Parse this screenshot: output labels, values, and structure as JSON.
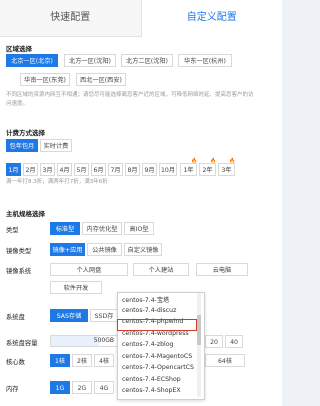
{
  "tabs": [
    {
      "label": "快速配置"
    },
    {
      "label": "自定义配置"
    }
  ],
  "region": {
    "title": "区域选择",
    "options": [
      "北京一区(北京)",
      "北方一区(沈阳)",
      "北方二区(沈阳)",
      "华东一区(杭州)",
      "华南一区(东莞)",
      "西北一区(西安)"
    ],
    "note_line1": "不同区域的资源内网互不相通；请您尽可能选择离您客户近的区域，可降低网络时延、提高您客户的访",
    "note_line2": "问速度。"
  },
  "billing": {
    "title": "计费方式选择",
    "options": [
      "包年包月",
      "实时计费"
    ],
    "months": [
      "1月",
      "2月",
      "3月",
      "4月",
      "5月",
      "6月",
      "7月",
      "8月",
      "9月",
      "10月",
      "1年",
      "2年",
      "3年"
    ],
    "note": "满一年打8.3折，满两年打7折，满3年6折"
  },
  "host": {
    "title": "主机规格选择",
    "type_label": "类型",
    "type_options": [
      "标准型",
      "内存优化型",
      "高IO型"
    ],
    "image_type_label": "镜像类型",
    "image_type_options": [
      "镜像+应用",
      "公共镜像",
      "自定义镜像"
    ],
    "image_system_label": "镜像系统",
    "image_system_options": [
      "个人网盘",
      "个人建站",
      "云电脑",
      "软件开发"
    ],
    "system_disk_label": "系统盘",
    "system_disk_options": [
      "SAS存储",
      "SSD存"
    ],
    "system_disk_size_label": "系统盘容量",
    "system_disk_size_value": "500GB",
    "disk_min": "20",
    "disk_max": "40",
    "cpu_label": "核心数",
    "cpu_options": [
      "1核",
      "2核",
      "4核"
    ],
    "cpu_option_right": "64核",
    "mem_label": "内存",
    "mem_options": [
      "1G",
      "2G",
      "4G"
    ]
  },
  "dropdown": {
    "items": [
      "centos-7.4-宝塔",
      "centos-7.4-discuz",
      "centos-7.4-phpwind",
      "centos-7.4-wordpress",
      "centos-7.4-zblog",
      "centos-7.4-MagentoCS",
      "centos-7.4-OpencartCS",
      "centos-7.4-ECShop",
      "centos-7.4-ShopEX"
    ],
    "highlighted_index": 3
  },
  "colors": {
    "accent": "#1e78e6",
    "highlight_border": "#d23a2b",
    "hot": "#e0541c"
  }
}
